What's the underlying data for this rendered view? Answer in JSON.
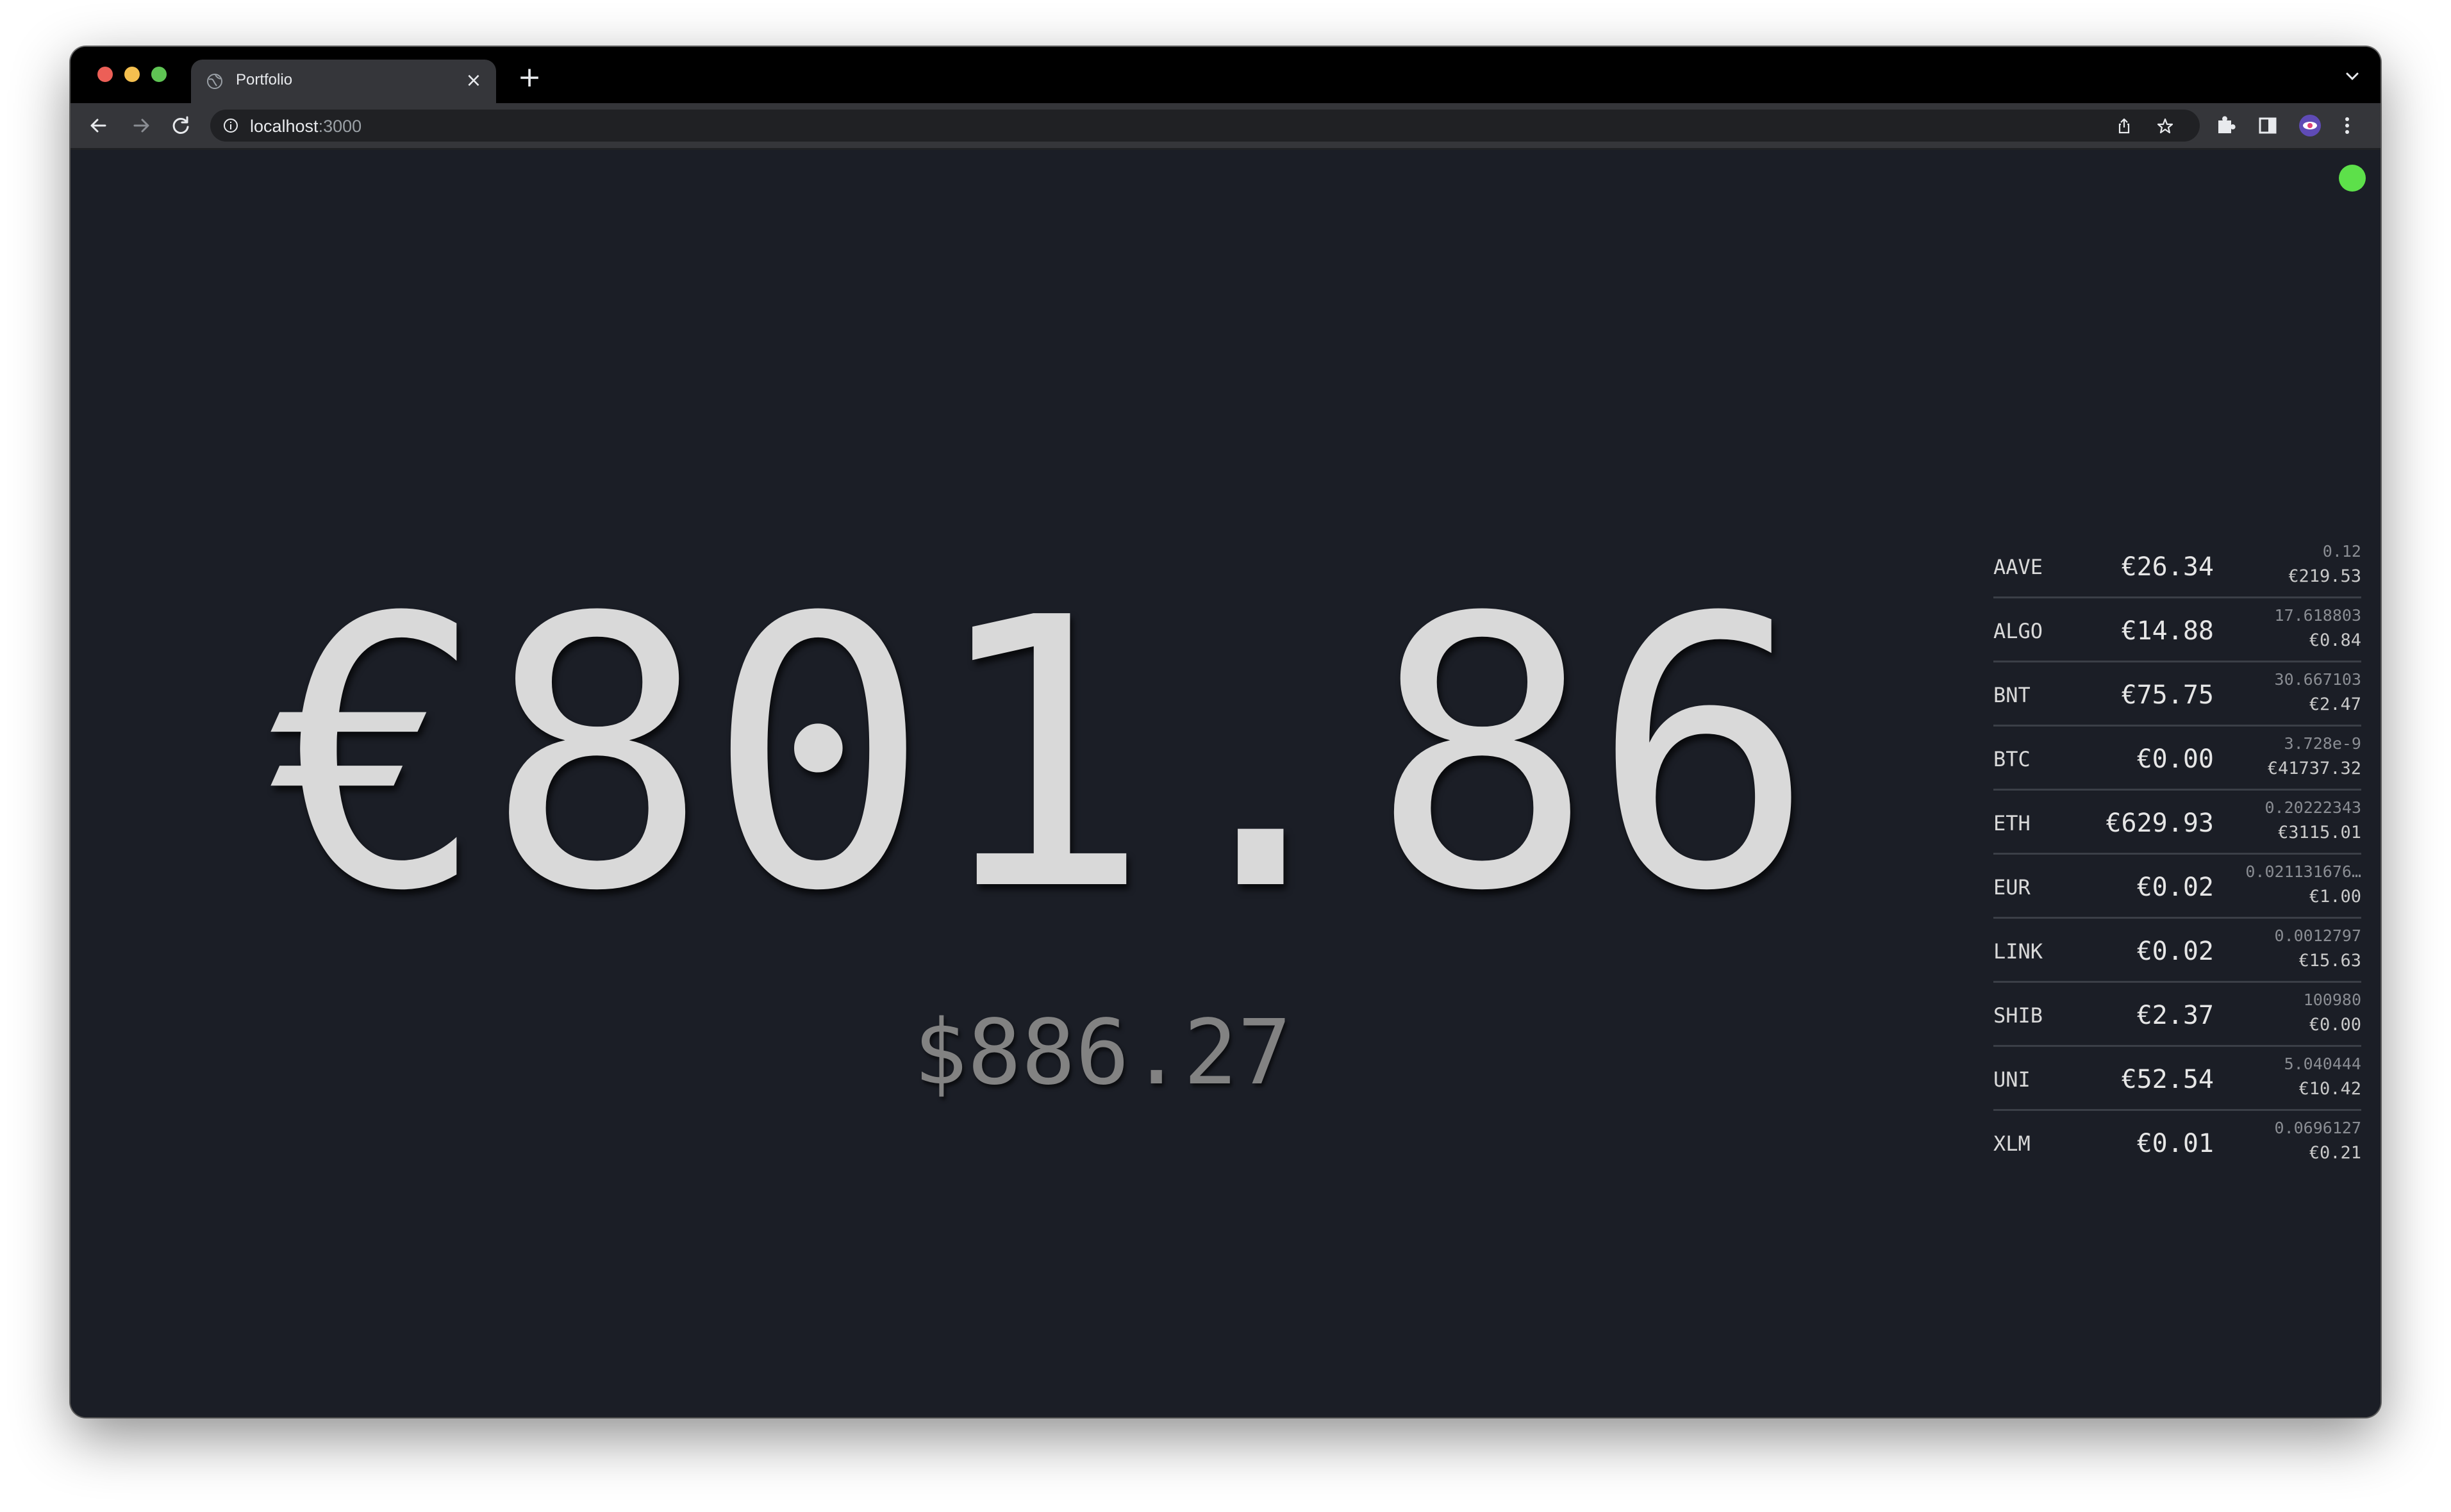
{
  "browser": {
    "tab_title": "Portfolio",
    "tab_close": "×",
    "new_tab": "+",
    "url_host": "localhost",
    "url_port": ":3000"
  },
  "portfolio": {
    "total_eur": "€801.86",
    "total_usd": "$886.27",
    "status": "connected",
    "status_color": "#5de04a"
  },
  "holdings": [
    {
      "symbol": "AAVE",
      "value": "€26.34",
      "quantity": "0.12",
      "price": "€219.53"
    },
    {
      "symbol": "ALGO",
      "value": "€14.88",
      "quantity": "17.618803",
      "price": "€0.84"
    },
    {
      "symbol": "BNT",
      "value": "€75.75",
      "quantity": "30.667103",
      "price": "€2.47"
    },
    {
      "symbol": "BTC",
      "value": "€0.00",
      "quantity": "3.728e-9",
      "price": "€41737.32"
    },
    {
      "symbol": "ETH",
      "value": "€629.93",
      "quantity": "0.20222343",
      "price": "€3115.01"
    },
    {
      "symbol": "EUR",
      "value": "€0.02",
      "quantity": "0.021131676…",
      "price": "€1.00"
    },
    {
      "symbol": "LINK",
      "value": "€0.02",
      "quantity": "0.0012797",
      "price": "€15.63"
    },
    {
      "symbol": "SHIB",
      "value": "€2.37",
      "quantity": "100980",
      "price": "€0.00"
    },
    {
      "symbol": "UNI",
      "value": "€52.54",
      "quantity": "5.040444",
      "price": "€10.42"
    },
    {
      "symbol": "XLM",
      "value": "€0.01",
      "quantity": "0.0696127",
      "price": "€0.21"
    }
  ],
  "icons": {
    "back": "arrow-left-icon",
    "forward": "arrow-right-icon",
    "reload": "reload-icon",
    "info": "info-icon",
    "share": "share-icon",
    "bookmark": "star-icon",
    "extensions": "puzzle-icon",
    "sidepanel": "side-panel-icon",
    "profile": "profile-icon",
    "menu": "kebab-menu-icon"
  }
}
